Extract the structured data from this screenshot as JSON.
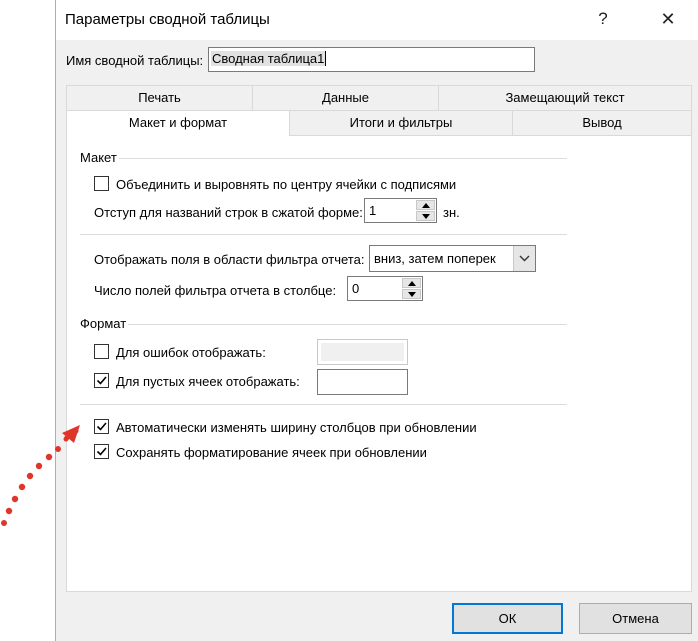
{
  "window": {
    "title": "Параметры сводной таблицы",
    "help_glyph": "?",
    "close_glyph": "✕"
  },
  "name_field": {
    "label": "Имя сводной таблицы:",
    "value": "Сводная таблица1"
  },
  "tabs": {
    "row1": [
      {
        "label": "Печать"
      },
      {
        "label": "Данные"
      },
      {
        "label": "Замещающий текст"
      }
    ],
    "row2": [
      {
        "label": "Макет и формат",
        "active": true
      },
      {
        "label": "Итоги и фильтры"
      },
      {
        "label": "Вывод"
      }
    ]
  },
  "layout_section": {
    "title": "Макет",
    "merge_checkbox": {
      "label": "Объединить и выровнять по центру ячейки с подписями",
      "checked": false
    },
    "indent": {
      "label": "Отступ для названий строк в сжатой форме:",
      "value": "1",
      "unit": "зн."
    },
    "filter_order": {
      "label": "Отображать поля в области фильтра отчета:",
      "value": "вниз, затем поперек"
    },
    "filter_count": {
      "label": "Число полей фильтра отчета в столбце:",
      "value": "0"
    }
  },
  "format_section": {
    "title": "Формат",
    "errors_checkbox": {
      "label": "Для ошибок отображать:",
      "checked": false,
      "value": ""
    },
    "empty_checkbox": {
      "label": "Для пустых ячеек отображать:",
      "checked": true,
      "value": ""
    },
    "autofit_checkbox": {
      "label": "Автоматически изменять ширину столбцов при обновлении",
      "checked": true
    },
    "preserve_checkbox": {
      "label": "Сохранять форматирование ячеек при обновлении",
      "checked": true
    }
  },
  "buttons": {
    "ok": "ОК",
    "cancel": "Отмена"
  },
  "colors": {
    "accent": "#0078d7",
    "annotation": "#e0352b"
  }
}
